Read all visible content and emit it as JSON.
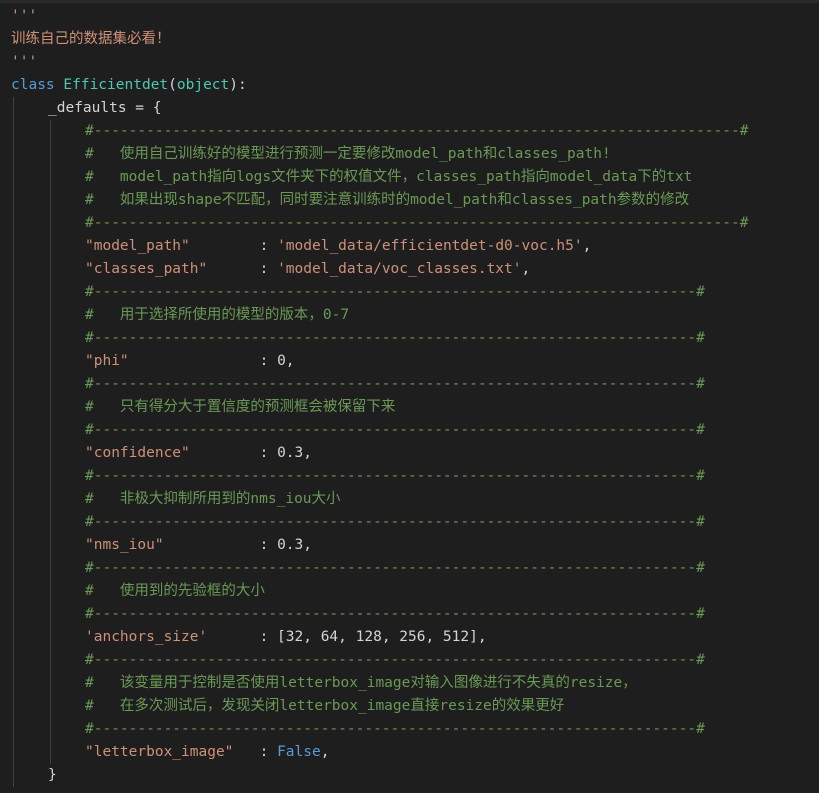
{
  "editor": {
    "lines": [
      {
        "indent": 0,
        "parts": [
          {
            "cls": "str",
            "text": "'''"
          }
        ]
      },
      {
        "indent": 0,
        "parts": [
          {
            "cls": "str",
            "text": "训练自己的数据集必看！"
          }
        ]
      },
      {
        "indent": 0,
        "parts": [
          {
            "cls": "str",
            "text": "'''"
          }
        ]
      },
      {
        "indent": 0,
        "parts": [
          {
            "cls": "kw",
            "text": "class "
          },
          {
            "cls": "cls",
            "text": "Efficientdet"
          },
          {
            "cls": "punc",
            "text": "("
          },
          {
            "cls": "cls",
            "text": "object"
          },
          {
            "cls": "punc",
            "text": "):"
          }
        ]
      },
      {
        "indent": 1,
        "parts": [
          {
            "cls": "txt",
            "text": "_defaults = {"
          }
        ]
      },
      {
        "indent": 2,
        "parts": [
          {
            "cls": "cm",
            "text": "#--------------------------------------------------------------------------#"
          }
        ]
      },
      {
        "indent": 2,
        "parts": [
          {
            "cls": "cm",
            "text": "#   使用自己训练好的模型进行预测一定要修改model_path和classes_path!"
          }
        ]
      },
      {
        "indent": 2,
        "parts": [
          {
            "cls": "cm",
            "text": "#   model_path指向logs文件夹下的权值文件，classes_path指向model_data下的txt"
          }
        ]
      },
      {
        "indent": 2,
        "parts": [
          {
            "cls": "cm",
            "text": "#   如果出现shape不匹配，同时要注意训练时的model_path和classes_path参数的修改"
          }
        ]
      },
      {
        "indent": 2,
        "parts": [
          {
            "cls": "cm",
            "text": "#--------------------------------------------------------------------------#"
          }
        ]
      },
      {
        "indent": 2,
        "parts": [
          {
            "cls": "str",
            "text": "\"model_path\""
          },
          {
            "cls": "punc",
            "text": "        : "
          },
          {
            "cls": "str",
            "text": "'model_data/efficientdet-d0-voc.h5'"
          },
          {
            "cls": "punc",
            "text": ","
          }
        ]
      },
      {
        "indent": 2,
        "parts": [
          {
            "cls": "str",
            "text": "\"classes_path\""
          },
          {
            "cls": "punc",
            "text": "      : "
          },
          {
            "cls": "str",
            "text": "'model_data/voc_classes.txt'"
          },
          {
            "cls": "punc",
            "text": ","
          }
        ]
      },
      {
        "indent": 2,
        "parts": [
          {
            "cls": "cm",
            "text": "#---------------------------------------------------------------------#"
          }
        ]
      },
      {
        "indent": 2,
        "parts": [
          {
            "cls": "cm",
            "text": "#   用于选择所使用的模型的版本，0-7"
          }
        ]
      },
      {
        "indent": 2,
        "parts": [
          {
            "cls": "cm",
            "text": "#---------------------------------------------------------------------#"
          }
        ]
      },
      {
        "indent": 2,
        "parts": [
          {
            "cls": "str",
            "text": "\"phi\""
          },
          {
            "cls": "punc",
            "text": "               : "
          },
          {
            "cls": "num",
            "text": "0"
          },
          {
            "cls": "punc",
            "text": ","
          }
        ]
      },
      {
        "indent": 2,
        "parts": [
          {
            "cls": "cm",
            "text": "#---------------------------------------------------------------------#"
          }
        ]
      },
      {
        "indent": 2,
        "parts": [
          {
            "cls": "cm",
            "text": "#   只有得分大于置信度的预测框会被保留下来"
          }
        ]
      },
      {
        "indent": 2,
        "parts": [
          {
            "cls": "cm",
            "text": "#---------------------------------------------------------------------#"
          }
        ]
      },
      {
        "indent": 2,
        "parts": [
          {
            "cls": "str",
            "text": "\"confidence\""
          },
          {
            "cls": "punc",
            "text": "        : "
          },
          {
            "cls": "num",
            "text": "0.3"
          },
          {
            "cls": "punc",
            "text": ","
          }
        ]
      },
      {
        "indent": 2,
        "parts": [
          {
            "cls": "cm",
            "text": "#---------------------------------------------------------------------#"
          }
        ]
      },
      {
        "indent": 2,
        "parts": [
          {
            "cls": "cm",
            "text": "#   非极大抑制所用到的nms_iou大小"
          }
        ]
      },
      {
        "indent": 2,
        "parts": [
          {
            "cls": "cm",
            "text": "#---------------------------------------------------------------------#"
          }
        ]
      },
      {
        "indent": 2,
        "parts": [
          {
            "cls": "str",
            "text": "\"nms_iou\""
          },
          {
            "cls": "punc",
            "text": "           : "
          },
          {
            "cls": "num",
            "text": "0.3"
          },
          {
            "cls": "punc",
            "text": ","
          }
        ]
      },
      {
        "indent": 2,
        "parts": [
          {
            "cls": "cm",
            "text": "#---------------------------------------------------------------------#"
          }
        ]
      },
      {
        "indent": 2,
        "parts": [
          {
            "cls": "cm",
            "text": "#   使用到的先验框的大小"
          }
        ]
      },
      {
        "indent": 2,
        "parts": [
          {
            "cls": "cm",
            "text": "#---------------------------------------------------------------------#"
          }
        ]
      },
      {
        "indent": 2,
        "parts": [
          {
            "cls": "str",
            "text": "'anchors_size'"
          },
          {
            "cls": "punc",
            "text": "      : [32, 64, 128, 256, 512],"
          }
        ]
      },
      {
        "indent": 2,
        "parts": [
          {
            "cls": "cm",
            "text": "#---------------------------------------------------------------------#"
          }
        ]
      },
      {
        "indent": 2,
        "parts": [
          {
            "cls": "cm",
            "text": "#   该变量用于控制是否使用letterbox_image对输入图像进行不失真的resize，"
          }
        ]
      },
      {
        "indent": 2,
        "parts": [
          {
            "cls": "cm",
            "text": "#   在多次测试后，发现关闭letterbox_image直接resize的效果更好"
          }
        ]
      },
      {
        "indent": 2,
        "parts": [
          {
            "cls": "cm",
            "text": "#---------------------------------------------------------------------#"
          }
        ]
      },
      {
        "indent": 2,
        "parts": [
          {
            "cls": "str",
            "text": "\"letterbox_image\""
          },
          {
            "cls": "punc",
            "text": "   : "
          },
          {
            "cls": "kw",
            "text": "False"
          },
          {
            "cls": "punc",
            "text": ","
          }
        ]
      },
      {
        "indent": 1,
        "parts": [
          {
            "cls": "punc",
            "text": "}"
          }
        ]
      }
    ]
  }
}
